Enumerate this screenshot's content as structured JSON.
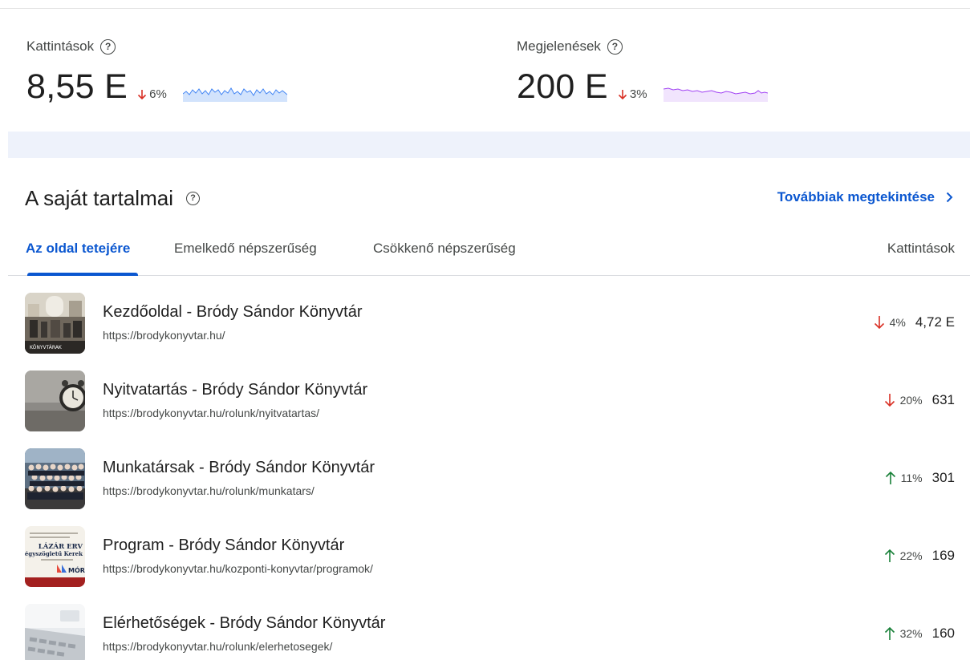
{
  "metrics": {
    "clicks": {
      "label": "Kattintások",
      "value": "8,55 E",
      "change": "6%",
      "direction": "down",
      "spark_color": "#4285f4"
    },
    "impressions": {
      "label": "Megjelenések",
      "value": "200 E",
      "change": "3%",
      "direction": "down",
      "spark_color": "#a142f4"
    }
  },
  "content": {
    "title": "A saját tartalmai",
    "more_label": "Továbbiak megtekintése",
    "tabs": [
      {
        "label": "Az oldal tetejére",
        "active": true
      },
      {
        "label": "Emelkedő népszerűség",
        "active": false
      },
      {
        "label": "Csökkenő népszerűség",
        "active": false
      }
    ],
    "column_header": "Kattintások",
    "rows": [
      {
        "title": "Kezdőoldal - Bródy Sándor Könyvtár",
        "url": "https://brodykonyvtar.hu/",
        "change": "4%",
        "direction": "down",
        "value": "4,72 E",
        "thumb_text": "KÖNYVTÁRAK"
      },
      {
        "title": "Nyitvatartás - Bródy Sándor Könyvtár",
        "url": "https://brodykonyvtar.hu/rolunk/nyitvatartas/",
        "change": "20%",
        "direction": "down",
        "value": "631"
      },
      {
        "title": "Munkatársak - Bródy Sándor Könyvtár",
        "url": "https://brodykonyvtar.hu/rolunk/munkatars/",
        "change": "11%",
        "direction": "up",
        "value": "301"
      },
      {
        "title": "Program - Bródy Sándor Könyvtár",
        "url": "https://brodykonyvtar.hu/kozponti-konyvtar/programok/",
        "change": "22%",
        "direction": "up",
        "value": "169",
        "thumb_text": [
          "LÁZÁR ERV",
          "„Négyszögletű Kerek",
          "MÓR"
        ]
      },
      {
        "title": "Elérhetőségek - Bródy Sándor Könyvtár",
        "url": "https://brodykonyvtar.hu/rolunk/elerhetosegek/",
        "change": "32%",
        "direction": "up",
        "value": "160"
      }
    ]
  },
  "colors": {
    "down": "#d93025",
    "up": "#188038",
    "link": "#0b57d0"
  }
}
